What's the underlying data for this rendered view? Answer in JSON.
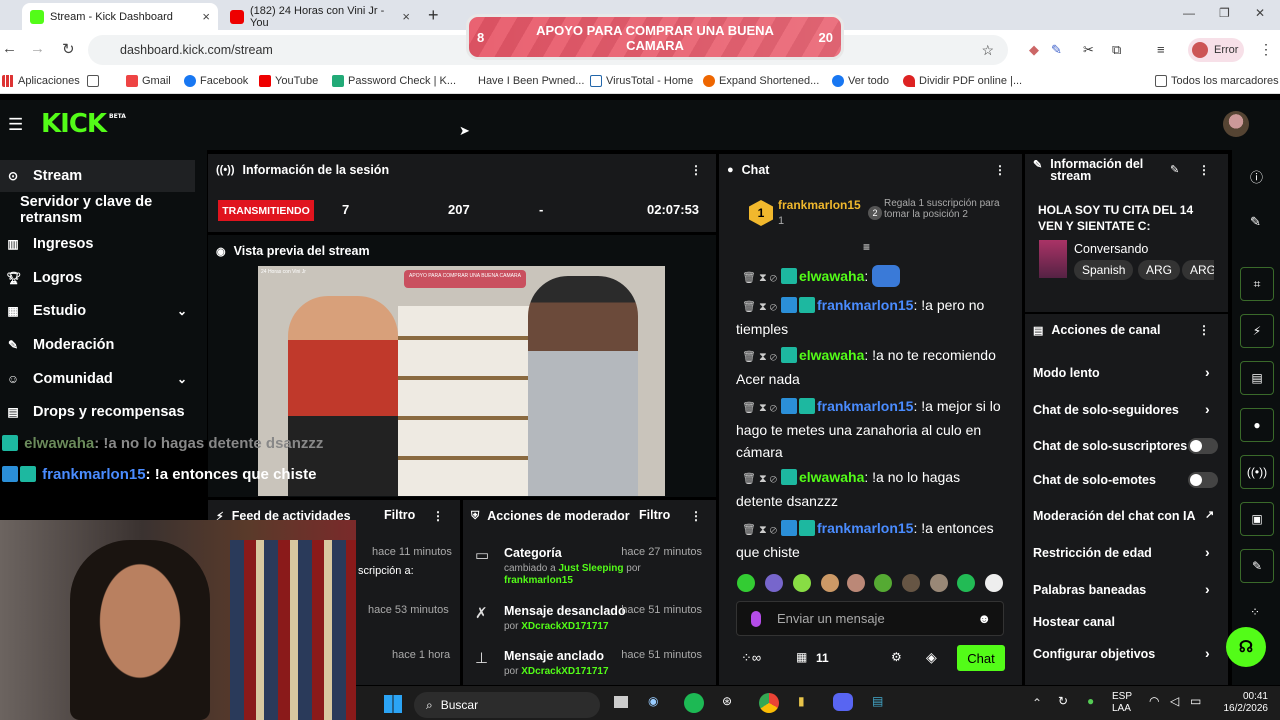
{
  "browser": {
    "tabs": [
      {
        "title": "Stream - Kick Dashboard",
        "active": true
      },
      {
        "title": "(182) 24 Horas con Vini Jr - You",
        "active": false
      }
    ],
    "url": "dashboard.kick.com/stream",
    "profile_label": "Error",
    "bookmarks": [
      "Aplicaciones",
      "Gmail",
      "Facebook",
      "YouTube",
      "Password Check | K...",
      "Have I Been Pwned...",
      "VirusTotal - Home",
      "Expand Shortened...",
      "Ver todo",
      "Dividir PDF online |...",
      "Todos los marcadores"
    ]
  },
  "goal_overlay": {
    "label": "APOYO PARA COMPRAR UNA BUENA CAMARA",
    "current": "8",
    "target": "20"
  },
  "brand": {
    "logo": "KICK",
    "beta": "BETA",
    "accent": "#53fc18"
  },
  "sidebar": {
    "items": [
      {
        "label": "Stream",
        "icon": "broadcast-icon"
      },
      {
        "label": "Servidor y clave de retransm"
      },
      {
        "label": "Ingresos",
        "icon": "bar-chart-icon"
      },
      {
        "label": "Logros",
        "icon": "trophy-icon"
      },
      {
        "label": "Estudio",
        "icon": "grid-icon"
      },
      {
        "label": "Moderación",
        "icon": "wrench-icon"
      },
      {
        "label": "Comunidad",
        "icon": "people-icon"
      },
      {
        "label": "Drops y recompensas",
        "icon": "gift-icon"
      }
    ]
  },
  "session": {
    "title": "Información de la sesión",
    "status": "TRANSMITIENDO",
    "viewers": "7",
    "followers": "207",
    "subs": "-",
    "uptime": "02:07:53"
  },
  "preview": {
    "title": "Vista previa del stream",
    "mini_goal": "APOYO PARA COMPRAR UNA BUENA CAMARA",
    "mini_caption": "24 Horas con Vini Jr"
  },
  "overlay_chat": [
    {
      "user": "elwawaha",
      "text": ": !a no lo hagas detente dsanzzz"
    },
    {
      "user": "frankmarlon15",
      "text": ": !a entonces que chiste"
    }
  ],
  "activity_feed": {
    "title": "Feed de actividades",
    "filter": "Filtro",
    "items": [
      {
        "text": "scripción a:",
        "time": "hace 11 minutos"
      },
      {
        "text": "",
        "time": "hace 53 minutos"
      },
      {
        "text": "",
        "time": "hace 1 hora"
      }
    ]
  },
  "mod_actions": {
    "title": "Acciones de moderador",
    "filter": "Filtro",
    "items": [
      {
        "title": "Categoría",
        "time": "hace 27 minutos",
        "sub1": "cambiado a ",
        "highlight": "Just Sleeping",
        "sub2": " por ",
        "user": "frankmarlon15"
      },
      {
        "title": "Mensaje desanclado",
        "time": "hace 51 minutos",
        "sub1": "por ",
        "user": "XDcrackXD171717"
      },
      {
        "title": "Mensaje anclado",
        "time": "hace 51 minutos",
        "sub1": "por ",
        "user": "XDcrackXD171717"
      }
    ]
  },
  "chat": {
    "title": "Chat",
    "top_gifter": {
      "rank": "1",
      "name": "frankmarlon15",
      "count": "1"
    },
    "gift_prompt": "Regala 1 suscripción para tomar la posición 2",
    "gift_badge": "2",
    "messages": [
      {
        "user": "elwawaha",
        "color": "green",
        "text": ":"
      },
      {
        "user": "frankmarlon15",
        "color": "blue",
        "text": ": !a pero no tiemples"
      },
      {
        "user": "elwawaha",
        "color": "green",
        "text": ": !a no te recomiendo Acer nada"
      },
      {
        "user": "frankmarlon15",
        "color": "blue",
        "text": ": !a mejor si lo hago te metes una zanahoria al culo en cámara"
      },
      {
        "user": "elwawaha",
        "color": "green",
        "text": ": !a no lo hagas detente dsanzzz"
      },
      {
        "user": "frankmarlon15",
        "color": "blue",
        "text": ": !a entonces que chiste"
      }
    ],
    "placeholder": "Enviar un mensaje",
    "viewer_count": "11",
    "send_label": "Chat"
  },
  "stream_info": {
    "title": "Información del stream",
    "stream_title": "HOLA SOY TU CITA DEL 14 VEN Y SIENTATE C:",
    "category": "Conversando",
    "tags": [
      "Spanish",
      "ARG",
      "ARG"
    ]
  },
  "channel_actions": {
    "title": "Acciones de canal",
    "items": [
      {
        "label": "Modo lento",
        "control": "chevron"
      },
      {
        "label": "Chat de solo-seguidores",
        "control": "chevron"
      },
      {
        "label": "Chat de solo-suscriptores",
        "control": "toggle"
      },
      {
        "label": "Chat de solo-emotes",
        "control": "toggle"
      },
      {
        "label": "Moderación del chat con IA",
        "control": "external"
      },
      {
        "label": "Restricción de edad",
        "control": "chevron"
      },
      {
        "label": "Palabras baneadas",
        "control": "chevron"
      },
      {
        "label": "Hostear canal",
        "control": "none"
      },
      {
        "label": "Configurar objetivos",
        "control": "chevron"
      }
    ]
  },
  "taskbar": {
    "search": "Buscar",
    "lang1": "ESP",
    "lang2": "LAA",
    "time": "00:41",
    "date": "16/2/2026"
  }
}
